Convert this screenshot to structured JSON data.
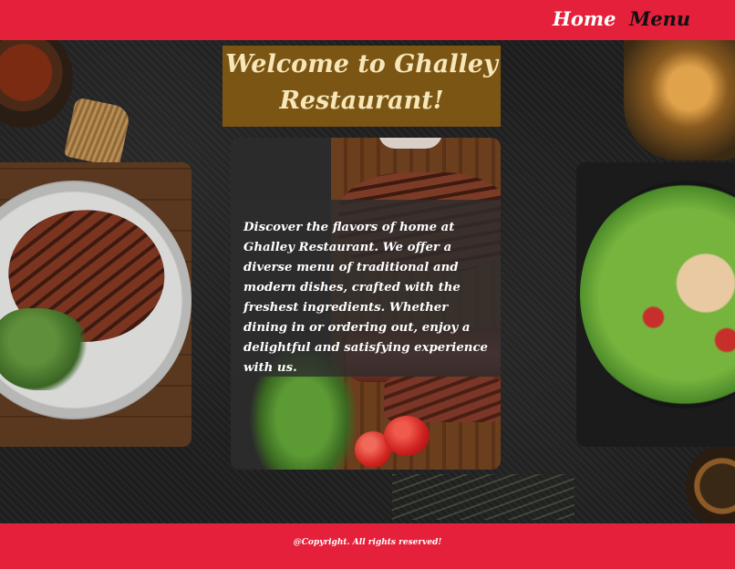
{
  "nav": {
    "home_label": "Home",
    "menu_label": "Menu"
  },
  "hero": {
    "title": "Welcome to Ghalley Restaurant!",
    "intro": "Discover the flavors of home at Ghalley Restaurant. We offer a diverse menu of traditional and modern dishes, crafted with the freshest ingredients. Whether dining in or ordering out, enjoy a delightful and satisfying experience with us."
  },
  "footer": {
    "copyright": "@Copyright. All rights reserved!"
  },
  "colors": {
    "brand_red": "#e5203a",
    "title_bg": "#7b5514",
    "title_text": "#f6e6b8"
  },
  "images": {
    "left": "grilled-steak-plate",
    "center": "steak-board-with-tomatoes",
    "right": "chicken-salad-bowl"
  }
}
